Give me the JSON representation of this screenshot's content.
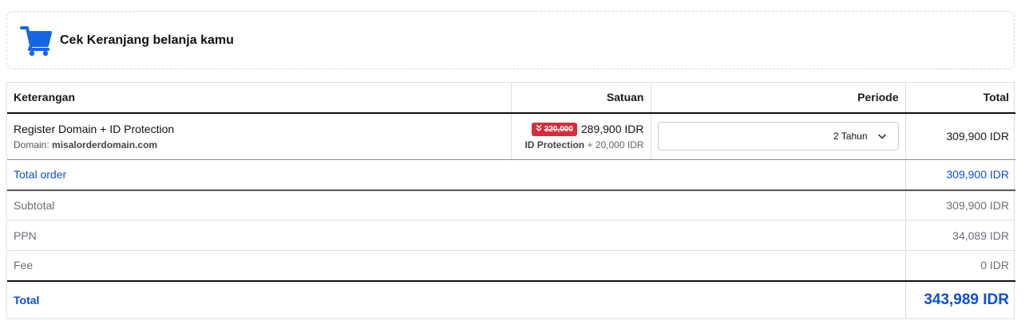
{
  "header": {
    "title": "Cek Keranjang belanja kamu",
    "icon": "cart-icon",
    "accent_color": "#1565e8"
  },
  "table": {
    "columns": [
      "Keterangan",
      "Satuan",
      "Periode",
      "Total"
    ],
    "item": {
      "name": "Register Domain + ID Protection",
      "domain_label": "Domain:",
      "domain_value": "misalorderdomain.com",
      "old_price": "320,000",
      "price": "289,900 IDR",
      "addon_label": "ID Protection",
      "addon_price": "+ 20,000 IDR",
      "period": "2 Tahun",
      "total": "309,900 IDR"
    },
    "total_order": {
      "label": "Total order",
      "value": "309,900 IDR"
    },
    "summary": [
      {
        "label": "Subtotal",
        "value": "309,900 IDR"
      },
      {
        "label": "PPN",
        "value": "34,089 IDR"
      },
      {
        "label": "Fee",
        "value": "0 IDR"
      }
    ],
    "grand_total": {
      "label": "Total",
      "value": "343,989 IDR"
    }
  },
  "colors": {
    "discount_badge": "#d92b3a",
    "link_blue": "#0a4fd6"
  }
}
